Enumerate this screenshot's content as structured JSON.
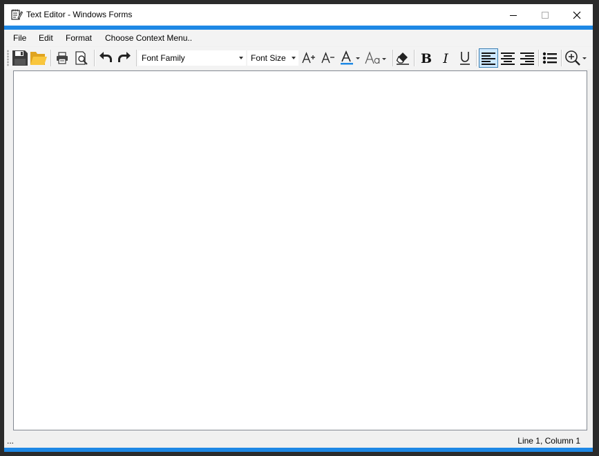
{
  "window": {
    "title": "Text Editor - Windows Forms",
    "accent_color": "#1e88e5"
  },
  "menu": {
    "items": [
      "File",
      "Edit",
      "Format",
      "Choose Context Menu.."
    ]
  },
  "toolbar": {
    "font_family": "Font Family",
    "font_size": "Font Size",
    "active_alignment": "align-left",
    "icons": [
      "save-icon",
      "open-folder-icon",
      "print-icon",
      "print-preview-icon",
      "undo-icon",
      "redo-icon",
      "increase-font-icon",
      "decrease-font-icon",
      "font-color-icon",
      "change-case-icon",
      "clear-format-icon",
      "bold-icon",
      "italic-icon",
      "underline-icon",
      "align-left-icon",
      "align-center-icon",
      "align-right-icon",
      "bullet-list-icon",
      "zoom-icon"
    ]
  },
  "editor": {
    "content": ""
  },
  "status": {
    "left": "...",
    "position": "Line 1, Column 1"
  }
}
